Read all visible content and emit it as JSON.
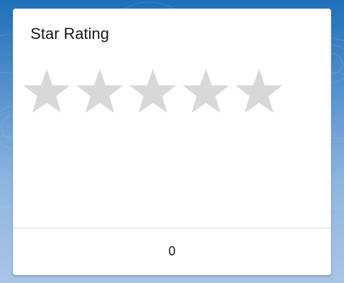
{
  "card": {
    "title": "Star Rating",
    "star_count": 5,
    "rating": "0",
    "star_color_empty": "#d8d8d8",
    "star_color_filled": "#ffb75d"
  }
}
